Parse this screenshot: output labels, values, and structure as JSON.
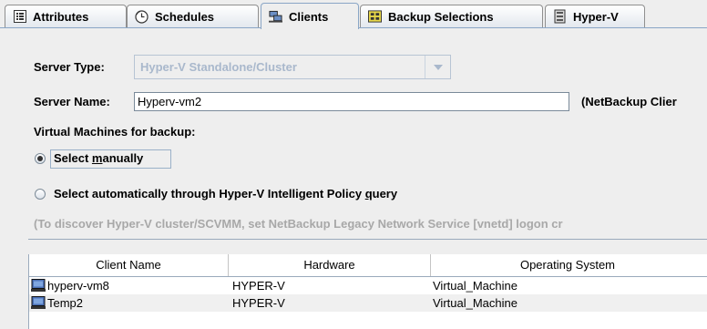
{
  "tabs": [
    {
      "label": "Attributes",
      "icon": "attributes-list-icon"
    },
    {
      "label": "Schedules",
      "icon": "schedule-clock-icon"
    },
    {
      "label": "Clients",
      "icon": "clients-computers-icon"
    },
    {
      "label": "Backup Selections",
      "icon": "backup-selections-icon"
    },
    {
      "label": "Hyper-V",
      "icon": "hyperv-server-icon"
    }
  ],
  "active_tab": "Clients",
  "form": {
    "server_type_label": "Server Type:",
    "server_type_value": "Hyper-V Standalone/Cluster",
    "server_name_label": "Server Name:",
    "server_name_value": "Hyperv-vm2",
    "server_name_note": "(NetBackup Clier",
    "vm_section_label": "Virtual Machines for backup:",
    "radio_manual_label_pre": "Select ",
    "radio_manual_label_mnemonic": "m",
    "radio_manual_label_post": "anually",
    "radio_auto_label_pre": "Select automatically through Hyper-V Intelligent Policy ",
    "radio_auto_label_mnemonic": "q",
    "radio_auto_label_post": "uery",
    "selected_radio": "manual",
    "hint": "(To discover Hyper-V cluster/SCVMM, set NetBackup Legacy Network Service [vnetd] logon cr"
  },
  "table": {
    "columns": [
      "Client Name",
      "Hardware",
      "Operating System"
    ],
    "rows": [
      [
        "hyperv-vm8",
        "HYPER-V",
        "Virtual_Machine"
      ],
      [
        "Temp2",
        "HYPER-V",
        "Virtual_Machine"
      ]
    ]
  },
  "colors": {
    "background": "#eeeeee",
    "tab_border": "#8f8f8f",
    "active_border": "#8aa6c6",
    "disabled_text": "#a9b8cc",
    "hint_text": "#a8a8a8"
  }
}
